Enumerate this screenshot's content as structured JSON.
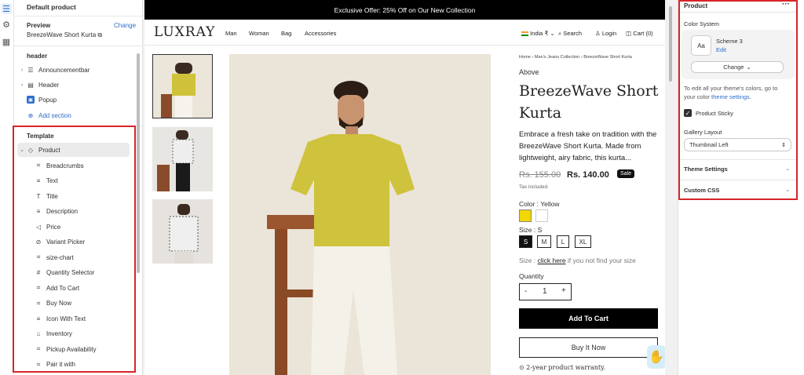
{
  "left_panel": {
    "title": "Default product",
    "preview_label": "Preview",
    "change_link": "Change",
    "preview_product": "BreezeWave Short Kurta",
    "header_group": "header",
    "header_items": [
      {
        "label": "Announcementbar",
        "icon": "list-icon"
      },
      {
        "label": "Header",
        "icon": "layout-icon"
      },
      {
        "label": "Popup",
        "icon": "popup-icon"
      }
    ],
    "add_section": "Add section",
    "template_group": "Template",
    "product_label": "Product",
    "blocks": [
      {
        "label": "Breadcrumbs",
        "icon": "block-icon"
      },
      {
        "label": "Text",
        "icon": "text-lines-icon"
      },
      {
        "label": "Title",
        "icon": "title-T-icon"
      },
      {
        "label": "Description",
        "icon": "text-lines-icon"
      },
      {
        "label": "Price",
        "icon": "price-tag-icon"
      },
      {
        "label": "Variant Picker",
        "icon": "variant-icon"
      },
      {
        "label": "size-chart",
        "icon": "block-icon"
      },
      {
        "label": "Quantity Selector",
        "icon": "hash-icon"
      },
      {
        "label": "Add To Cart",
        "icon": "block-icon"
      },
      {
        "label": "Buy Now",
        "icon": "block-icon"
      },
      {
        "label": "Icon With Text",
        "icon": "text-lines-icon"
      },
      {
        "label": "Inventory",
        "icon": "inventory-icon"
      },
      {
        "label": "Pickup Availability",
        "icon": "block-icon"
      },
      {
        "label": "Pair it with",
        "icon": "block-icon"
      }
    ]
  },
  "store": {
    "announcement": "Exclusive Offer: 25% Off on Our New Collection",
    "logo": "LUXRAY",
    "nav": [
      "Man",
      "Woman",
      "Bag",
      "Accessories"
    ],
    "country": "India ₹",
    "search": "Search",
    "login": "Login",
    "cart": "Cart (0)",
    "breadcrumb": "Home › Man's Jeans Collection › BreezeWave Short Kurta",
    "above_text": "Above",
    "title_line1": "BreezeWave Short",
    "title_line2": "Kurta",
    "desc_line1": "Embrace a fresh take on tradition with the",
    "desc_line2": "BreezeWave Short Kurta. Made from",
    "desc_line3": "lightweight, airy fabric, this kurta...",
    "compare_price": "Rs. 155.00",
    "price": "Rs. 140.00",
    "sale_badge": "Sale",
    "tax_note": "Tax included.",
    "color_label": "Color : Yellow",
    "size_label": "Size : S",
    "sizes": [
      "S",
      "M",
      "L",
      "XL"
    ],
    "selected_size": "S",
    "sizechart_prefix": "Size :",
    "sizechart_link": "click here",
    "sizechart_suffix": "if you not find your size",
    "quantity_label": "Quantity",
    "quantity_minus": "-",
    "quantity_value": "1",
    "quantity_plus": "+",
    "add_to_cart": "Add To Cart",
    "buy_now": "Buy It Now",
    "warranty": "2-year product warranty.",
    "colors": {
      "yellow": "#f2d600",
      "white": "#ffffff"
    }
  },
  "right_panel": {
    "title": "Product",
    "more": "···",
    "color_system_label": "Color System",
    "scheme_preview": "Aa",
    "scheme_name": "Scheme 3",
    "scheme_edit": "Edit",
    "change_button": "Change",
    "help_line1": "To edit all your theme's colors, go to",
    "help_prefix": "your color ",
    "help_link": "theme settings.",
    "sticky_label": "Product Sticky",
    "gallery_label": "Gallery Layout",
    "gallery_value": "Thumbnail Left",
    "theme_settings": "Theme Settings",
    "custom_css": "Custom CSS"
  }
}
